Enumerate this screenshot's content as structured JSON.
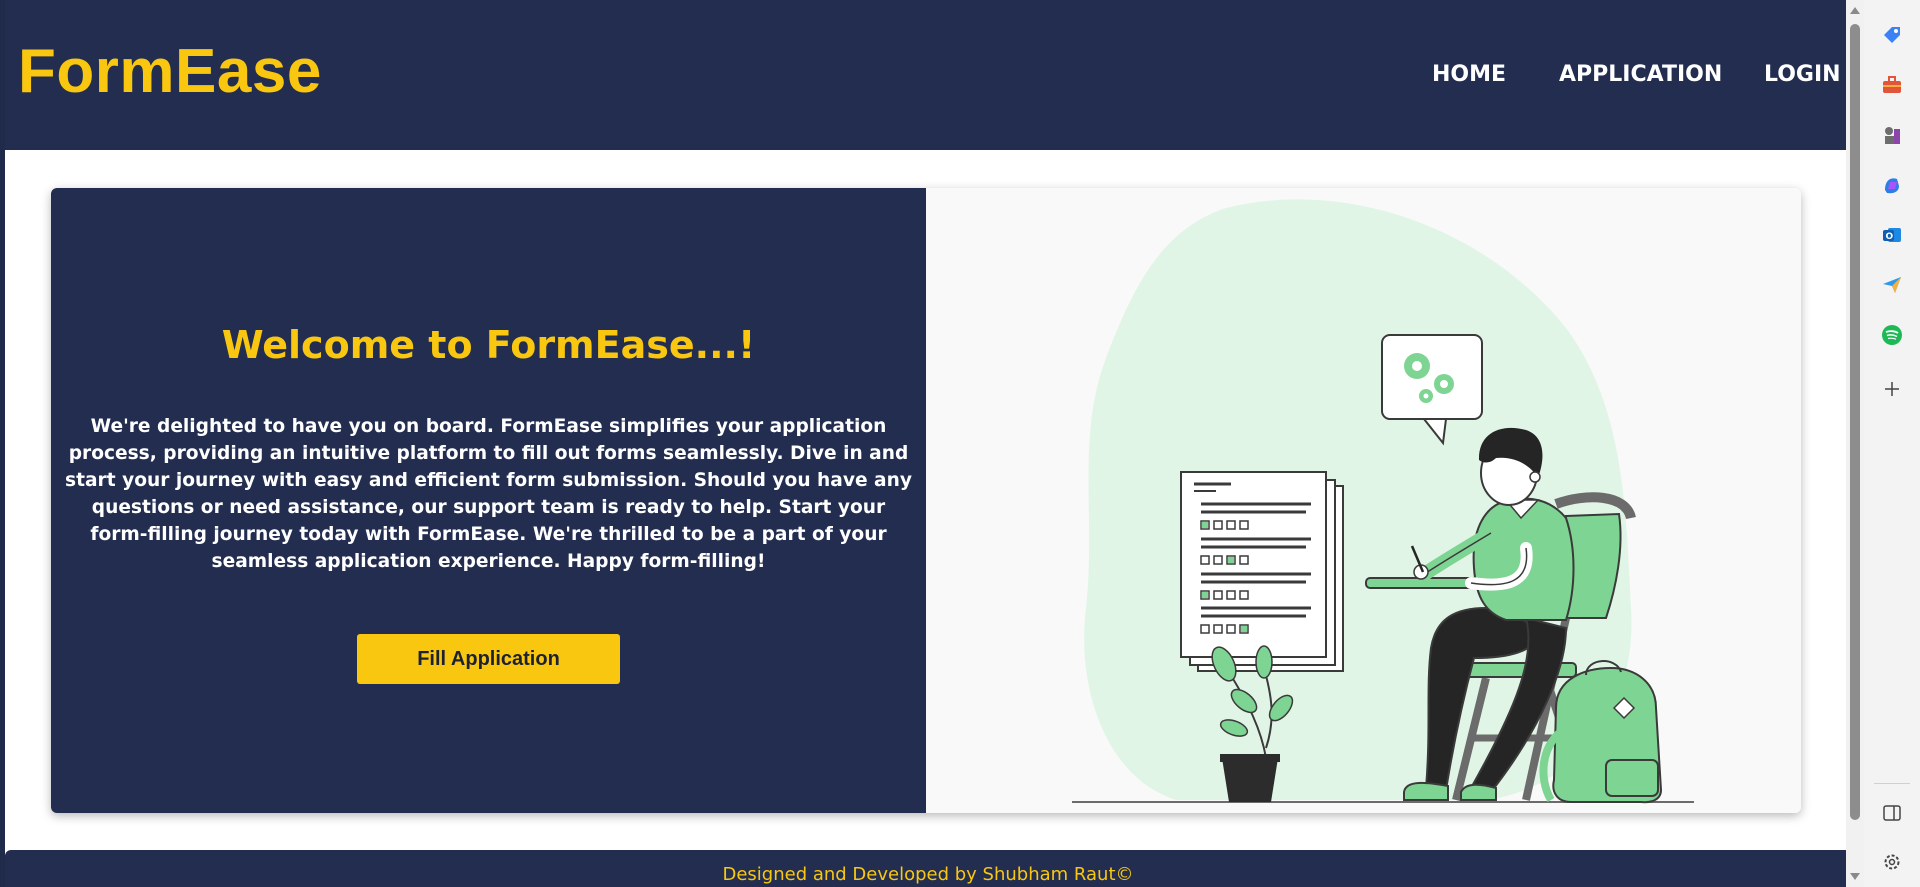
{
  "brand": {
    "name": "FormEase",
    "color": "#f9c710"
  },
  "nav": {
    "items": [
      {
        "label": "HOME"
      },
      {
        "label": "APPLICATION"
      },
      {
        "label": "LOGIN"
      }
    ]
  },
  "hero": {
    "heading": "Welcome to FormEase...!",
    "paragraph": "We're delighted to have you on board. FormEase simplifies your application process, providing an intuitive platform to fill out forms seamlessly. Dive in and start your journey with easy and efficient form submission. Should you have any questions or need assistance, our support team is ready to help. Start your form-filling journey today with FormEase. We're thrilled to be a part of your seamless application experience. Happy form-filling!",
    "button_label": "Fill Application"
  },
  "illustration": {
    "subject": "person-filling-form-illustration",
    "accent_color": "#7ed492"
  },
  "footer": {
    "text": "Designed and Developed by Shubham Raut©"
  },
  "browser_sidebar": {
    "icons": [
      "tag-icon",
      "toolbox-icon",
      "chess-icon",
      "copilot-icon",
      "outlook-icon",
      "send-icon",
      "spotify-icon",
      "add-icon",
      "panel-toggle-icon",
      "settings-icon"
    ]
  },
  "colors": {
    "navy": "#222d50",
    "yellow": "#f9c710",
    "white": "#ffffff",
    "green_light": "#dff5e5",
    "green": "#7ed492"
  }
}
